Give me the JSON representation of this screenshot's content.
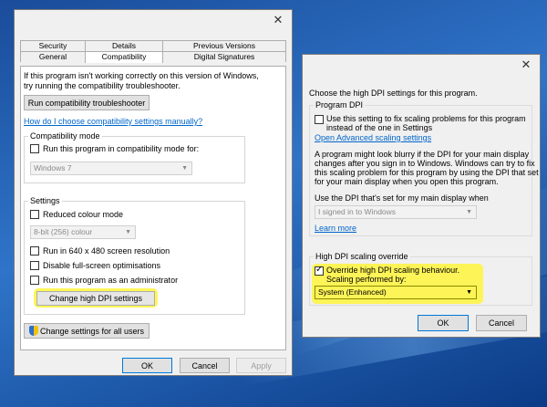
{
  "compat_dialog": {
    "tabs_top": [
      "Security",
      "Details",
      "Previous Versions"
    ],
    "tabs_bottom": [
      "General",
      "Compatibility",
      "Digital Signatures"
    ],
    "intro_line1": "If this program isn't working correctly on this version of Windows,",
    "intro_line2": "try running the compatibility troubleshooter.",
    "troubleshooter_button": "Run compatibility troubleshooter",
    "help_link": "How do I choose compatibility settings manually?",
    "compat_mode": {
      "group_label": "Compatibility mode",
      "checkbox_label": "Run this program in compatibility mode for:",
      "os_value": "Windows 7"
    },
    "settings": {
      "group_label": "Settings",
      "reduced_colour": "Reduced colour mode",
      "colour_value": "8-bit (256) colour",
      "res_640": "Run in 640 x 480 screen resolution",
      "disable_fullscreen": "Disable full-screen optimisations",
      "run_admin": "Run this program as an administrator",
      "dpi_button": "Change high DPI settings"
    },
    "all_users_button": "Change settings for all users",
    "ok": "OK",
    "cancel": "Cancel",
    "apply": "Apply"
  },
  "dpi_dialog": {
    "heading": "Choose the high DPI settings for this program.",
    "program_dpi": {
      "group_label": "Program DPI",
      "checkbox_line1": "Use this setting to fix scaling problems for this program",
      "checkbox_line2": "instead of the one in Settings",
      "advanced_link": "Open Advanced scaling settings",
      "desc1": "A program might look blurry if the DPI for your main display",
      "desc2": "changes after you sign in to Windows. Windows can try to fix",
      "desc3": "this scaling problem for this program by using the DPI that set",
      "desc4": "for your main display when you open this program.",
      "use_dpi_label": "Use the DPI that's set for my main display when",
      "signin_value": "I signed in to Windows",
      "learn_more": "Learn more"
    },
    "override": {
      "group_label": "High DPI scaling override",
      "checkbox_line1": "Override high DPI scaling behaviour.",
      "checkbox_line2": "Scaling performed by:",
      "scaling_value": "System (Enhanced)"
    },
    "ok": "OK",
    "cancel": "Cancel"
  },
  "colors": {
    "highlight": "#fff53c",
    "link": "#0066cc",
    "focus_border": "#0078d7"
  }
}
